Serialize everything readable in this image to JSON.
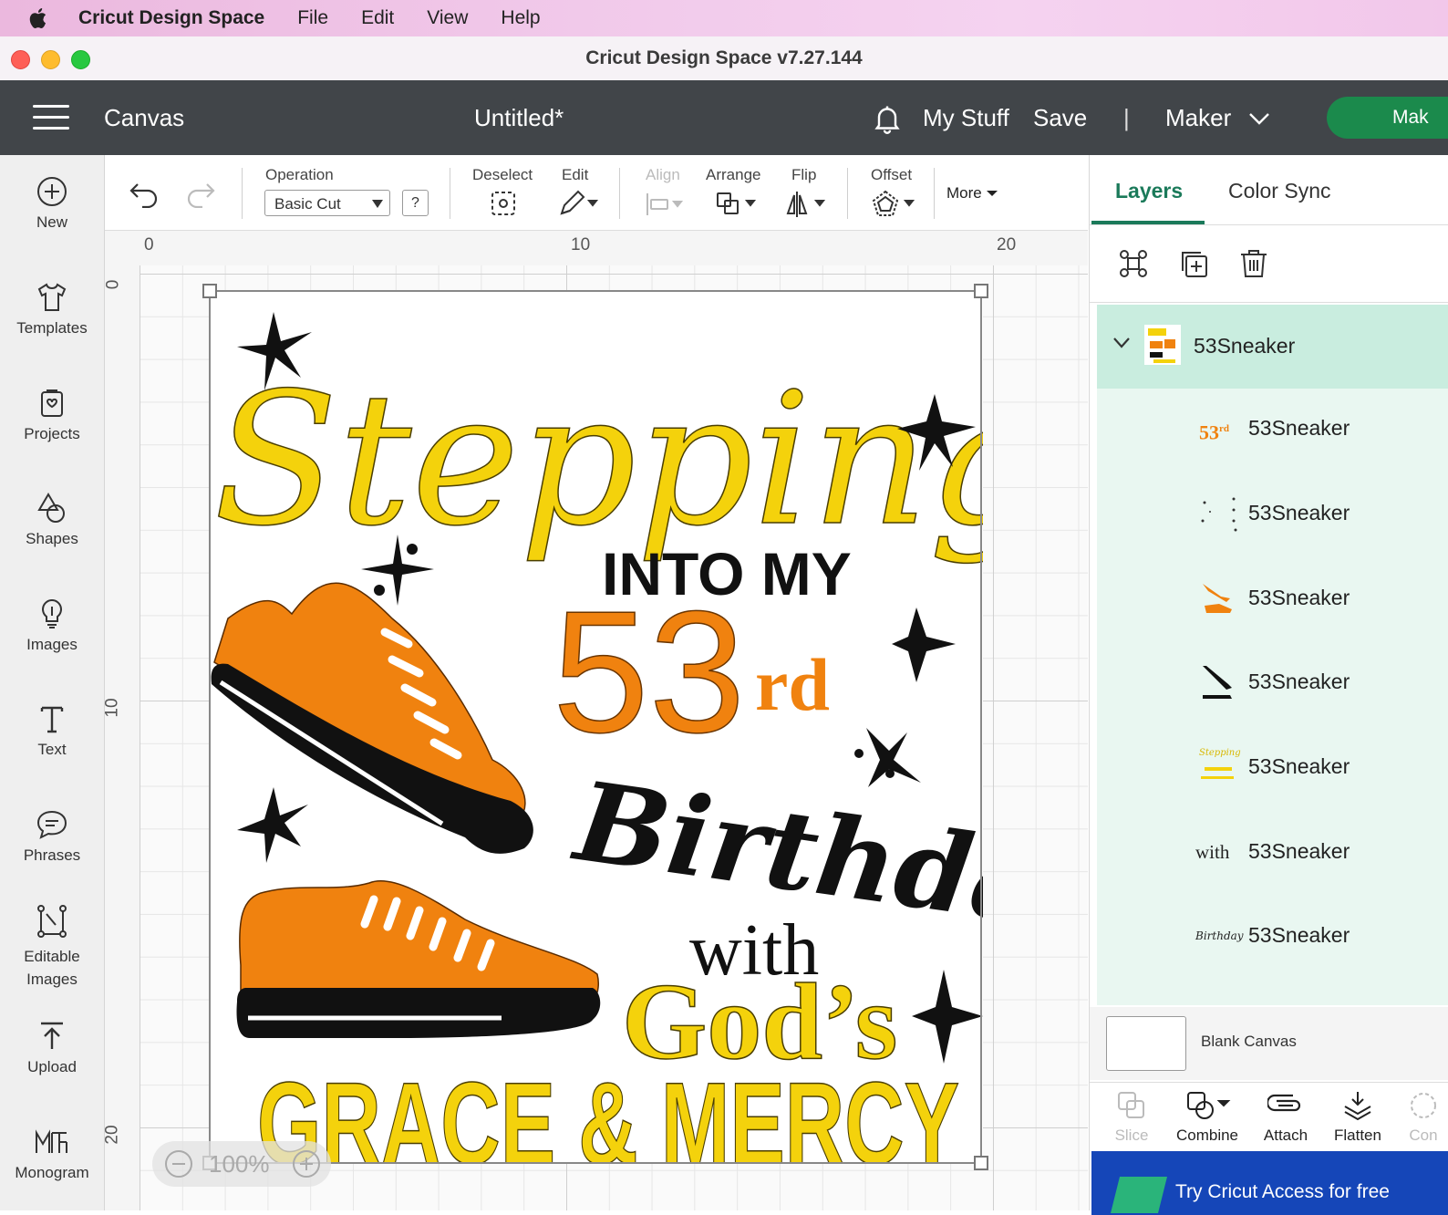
{
  "menubar": {
    "app_name": "Cricut Design Space",
    "items": [
      "File",
      "Edit",
      "View",
      "Help"
    ]
  },
  "window": {
    "title": "Cricut Design Space  v7.27.144"
  },
  "header": {
    "section": "Canvas",
    "doc_title": "Untitled*",
    "my_stuff": "My Stuff",
    "save": "Save",
    "separator": "|",
    "machine": "Maker",
    "make_button": "Mak"
  },
  "sidebar": {
    "items": [
      {
        "label": "New",
        "icon": "plus-circle-icon"
      },
      {
        "label": "Templates",
        "icon": "shirt-icon"
      },
      {
        "label": "Projects",
        "icon": "projects-icon"
      },
      {
        "label": "Shapes",
        "icon": "shapes-icon"
      },
      {
        "label": "Images",
        "icon": "lightbulb-icon"
      },
      {
        "label": "Text",
        "icon": "text-icon"
      },
      {
        "label": "Phrases",
        "icon": "speech-bubble-icon"
      },
      {
        "label": "Editable",
        "label2": "Images",
        "icon": "editable-images-icon"
      },
      {
        "label": "Upload",
        "icon": "upload-icon"
      },
      {
        "label": "Monogram",
        "icon": "monogram-icon"
      }
    ]
  },
  "toolbar": {
    "operation_label": "Operation",
    "operation_value": "Basic Cut",
    "help": "?",
    "deselect": "Deselect",
    "edit": "Edit",
    "align": "Align",
    "arrange": "Arrange",
    "flip": "Flip",
    "offset": "Offset",
    "more": "More"
  },
  "rulers": {
    "top": [
      "0",
      "10",
      "20"
    ],
    "left": [
      "0",
      "10",
      "20"
    ]
  },
  "canvas": {
    "zoom": "100%",
    "design_text": {
      "line1": "Stepping",
      "line2": "INTO MY",
      "number": "53",
      "suffix": "rd",
      "line4": "Birthday",
      "line5": "with",
      "line6": "God’s",
      "line7": "GRACE & MERCY"
    },
    "colors": {
      "yellow": "#f4d20c",
      "orange": "#f0820f",
      "black": "#111111"
    }
  },
  "right_panel": {
    "tabs": [
      "Layers",
      "Color Sync"
    ],
    "group": {
      "name": "53Sneaker"
    },
    "layers": [
      {
        "name": "53Sneaker",
        "thumb": "53rd"
      },
      {
        "name": "53Sneaker",
        "thumb": "stars"
      },
      {
        "name": "53Sneaker",
        "thumb": "orange-shoes"
      },
      {
        "name": "53Sneaker",
        "thumb": "black-soles"
      },
      {
        "name": "53Sneaker",
        "thumb": "yellow-text"
      },
      {
        "name": "53Sneaker",
        "thumb": "with"
      },
      {
        "name": "53Sneaker",
        "thumb": "Birthday"
      }
    ],
    "thumb_text": {
      "rd53": "53",
      "rd": "rd",
      "with": "with",
      "birthday": "Birthday",
      "stepping": "Stepping"
    },
    "blank_canvas": "Blank Canvas",
    "bottom_tools": [
      "Slice",
      "Combine",
      "Attach",
      "Flatten",
      "Con"
    ],
    "banner": "Try Cricut Access for free"
  }
}
